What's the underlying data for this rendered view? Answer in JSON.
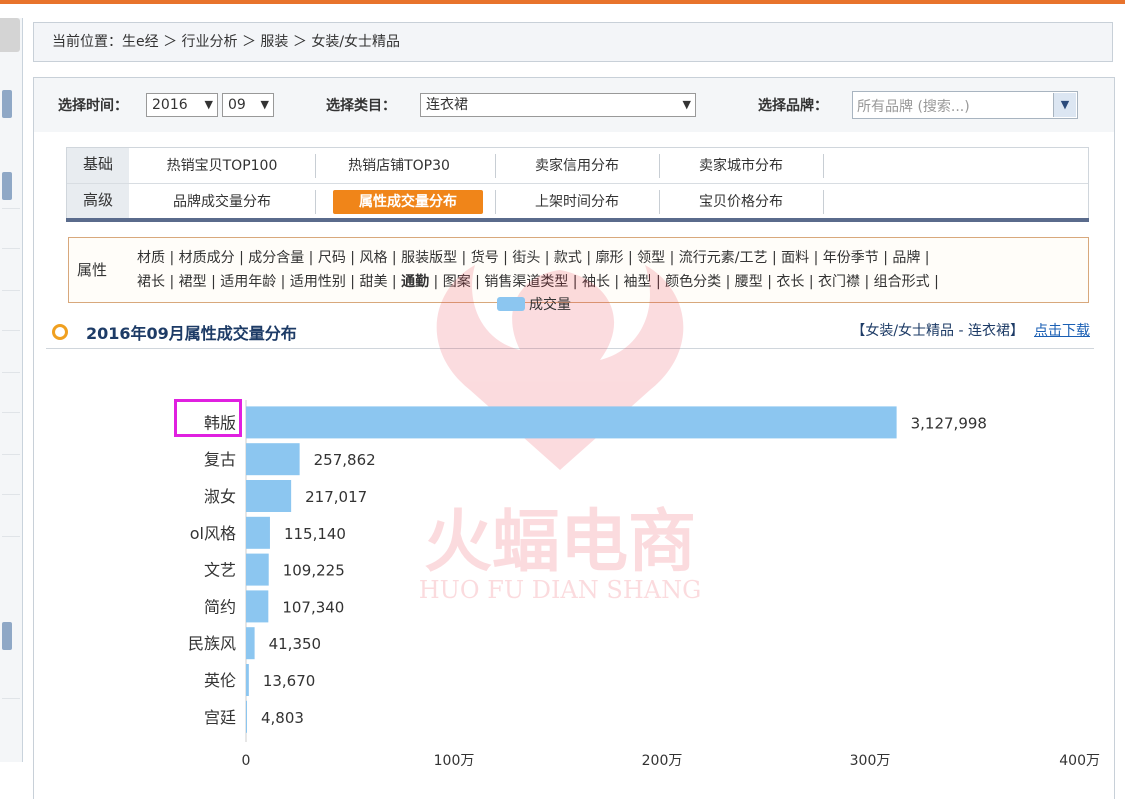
{
  "breadcrumb": "当前位置：生e经 ＞ 行业分析 ＞ 服装 ＞ 女装/女士精品",
  "filters": {
    "time_label": "选择时间：",
    "year": "2016",
    "month": "09",
    "category_label": "选择类目：",
    "category": "连衣裙",
    "brand_label": "选择品牌：",
    "brand_placeholder": "所有品牌 (搜索...)"
  },
  "tabs": {
    "basic_label": "基础",
    "advanced_label": "高级",
    "row1": [
      "热销宝贝TOP100",
      "热销店铺TOP30",
      "卖家信用分布",
      "卖家城市分布"
    ],
    "row2": [
      "品牌成交量分布",
      "属性成交量分布",
      "上架时间分布",
      "宝贝价格分布"
    ],
    "active": "属性成交量分布"
  },
  "attributes": {
    "label": "属性",
    "line1": "材质 | 材质成分 | 成分含量 | 尺码 | 风格 | 服装版型 | 货号 | 街头 | 款式 | 廓形 | 领型 | 流行元素/工艺 | 面料 | 年份季节 | 品牌 |",
    "line2_pre": "裙长 | 裙型 | 适用年龄 | 适用性别 | 甜美 | ",
    "line2_bold": "通勤",
    "line2_post": " | 图案 | 销售渠道类型 | 袖长 | 袖型 | 颜色分类 | 腰型 | 衣长 | 衣门襟 | 组合形式 |"
  },
  "section": {
    "title": "2016年09月属性成交量分布",
    "scope": "【女装/女士精品 - 连衣裙】",
    "download": "点击下载"
  },
  "watermark": {
    "cn": "火蝠电商",
    "en": "HUO FU DIAN SHANG"
  },
  "chart_data": {
    "type": "bar",
    "orientation": "horizontal",
    "legend": "成交量",
    "categories": [
      "韩版",
      "复古",
      "淑女",
      "ol风格",
      "文艺",
      "简约",
      "民族风",
      "英伦",
      "宫廷"
    ],
    "values": [
      3127998,
      257862,
      217017,
      115140,
      109225,
      107340,
      41350,
      13670,
      4803
    ],
    "value_labels": [
      "3,127,998",
      "257,862",
      "217,017",
      "115,140",
      "109,225",
      "107,340",
      "41,350",
      "13,670",
      "4,803"
    ],
    "xlim": [
      0,
      4000000
    ],
    "xticks": [
      0,
      1000000,
      2000000,
      3000000,
      4000000
    ],
    "xtick_labels": [
      "0",
      "100万",
      "200万",
      "300万",
      "400万"
    ],
    "highlighted": "韩版",
    "bar_color": "#8cc6f0"
  }
}
